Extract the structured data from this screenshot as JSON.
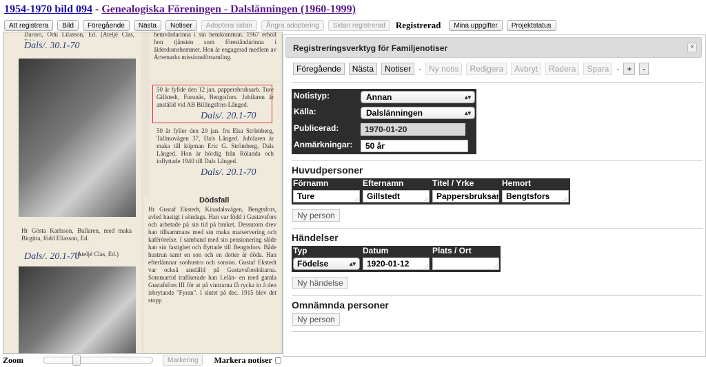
{
  "header": {
    "collection_link": "1954-1970 bild 094",
    "separator": "-",
    "source_link": "Genealogiska Föreningen - Dalslänningen (1960-1999)"
  },
  "toolbar": {
    "att_registrera": "Att registrera",
    "bild": "Bild",
    "foregaende": "Föregående",
    "nasta": "Nästa",
    "notiser": "Notiser",
    "adoptera_sidan": "Adoptera sidan",
    "angra_adoptering": "Ångra adoptering",
    "sidan_registrerad": "Sidan registrerad",
    "status": "Registrerad",
    "mina_uppgifter": "Mina uppgifter",
    "projektstatus": "Projektstatus"
  },
  "scan": {
    "hand1": "Dals/. 30.1-70",
    "top_caption": "Daroro, Odu Lilasson, Ed. (Ateljé Clas, Ed.)",
    "obit_top_text": "hemvårdarinna i sin hemkommun. 1967 erhöll hon tjänsten som föreståndarinna i ålderdomshemmet. Hon är engagerad medlem av Ärtemarks missionsförsamling.",
    "notice1_text": "50 år fyllde den 12 jan. pappersbruksarb. Ture Gillstedt, Furunäs, Bengtsfors. Jubilaren är anställd vid AB Billingsfors-Långed.",
    "hand2": "Dals/. 20.1-70",
    "notice2_text": "50 år fyller den 20 jan. fru Elsa Strömberg, Tallmovägen 37, Dals Långed. Jubilaren är maka till köpman Eric G. Strömberg, Dals Långed. Hon är bördig från Rölanda och inflyttade 1940 till Dals Långed.",
    "hand3": "Dals/. 20.1-70",
    "dodsfall_title": "Dödsfall",
    "dodsfall_text": "Hr Gustaf Ekstedt, Kinadalsvägen, Bengtsfors, avled hastigt i söndags. Han var född i Gustavsfors och arbetade på sin tid på bruket. Dessutom drev han tillsammans med sin maka matservering och kaféröreIse. I samband med sin pensionering sålde han sin fastighet och flyttade till Bengtsfors. Både hustrun samt en son och en dotter är döda. Han efterlämnar sonhustru och sonson. Gustaf Ekstedt var också anställd på Gustavsforsbåtarna. Sommartid trafikerade han Lelån- en med gamla Gustafsfors III för at på vintrarna få rycka in å den isbrytande \"Fyran\". I slutet på dec. 1915 blev det stopp",
    "caption2": "Hr Gösta Karlsson, Bullaren, med maka Birgitta, född Eliasson, Ed.",
    "caption2b": "(Ateljé Clas, Ed.)",
    "hand4": "Dals/. 20.1-70"
  },
  "bottom": {
    "zoom_label": "Zoom",
    "markering": "Markering",
    "markera_notiser": "Markera notiser"
  },
  "dialog": {
    "title": "Registreringsverktyg för Familjenotiser",
    "close": "×",
    "buttons": {
      "foregaende": "Föregående",
      "nasta": "Nästa",
      "notiser": "Notiser",
      "ny_notis": "Ny notis",
      "redigera": "Redigera",
      "avbryt": "Avbryt",
      "radera": "Radera",
      "spara": "Spara",
      "plus": "+",
      "minus": "-",
      "dash": "-"
    },
    "fields": {
      "notistyp_label": "Notistyp:",
      "notistyp_value": "Annan",
      "kalla_label": "Källa:",
      "kalla_value": "Dalslänningen",
      "publicerad_label": "Publicerad:",
      "publicerad_value": "1970-01-20",
      "anmarkningar_label": "Anmärkningar:",
      "anmarkningar_value": "50 år"
    },
    "huvudpersoner": {
      "heading": "Huvudpersoner",
      "col_fornamn": "Förnamn",
      "col_efternamn": "Efternamn",
      "col_titel": "Titel / Yrke",
      "col_hemort": "Hemort",
      "fornamn": "Ture",
      "efternamn": "Gillstedt",
      "titel": "Pappersbruksarb.",
      "hemort": "Bengtsfors",
      "ny_person": "Ny person"
    },
    "handelser": {
      "heading": "Händelser",
      "col_typ": "Typ",
      "col_datum": "Datum",
      "col_plats": "Plats / Ort",
      "typ": "Födelse",
      "datum": "1920-01-12",
      "plats": "",
      "ny_handelse": "Ny händelse"
    },
    "omnamnda": {
      "heading": "Omnämnda personer",
      "ny_person": "Ny person"
    }
  },
  "colors": {
    "link": "#1a0dab",
    "visited_link": "#5a1a8a",
    "label_bg": "#2d2d2d",
    "notice_highlight": "#e03030"
  }
}
